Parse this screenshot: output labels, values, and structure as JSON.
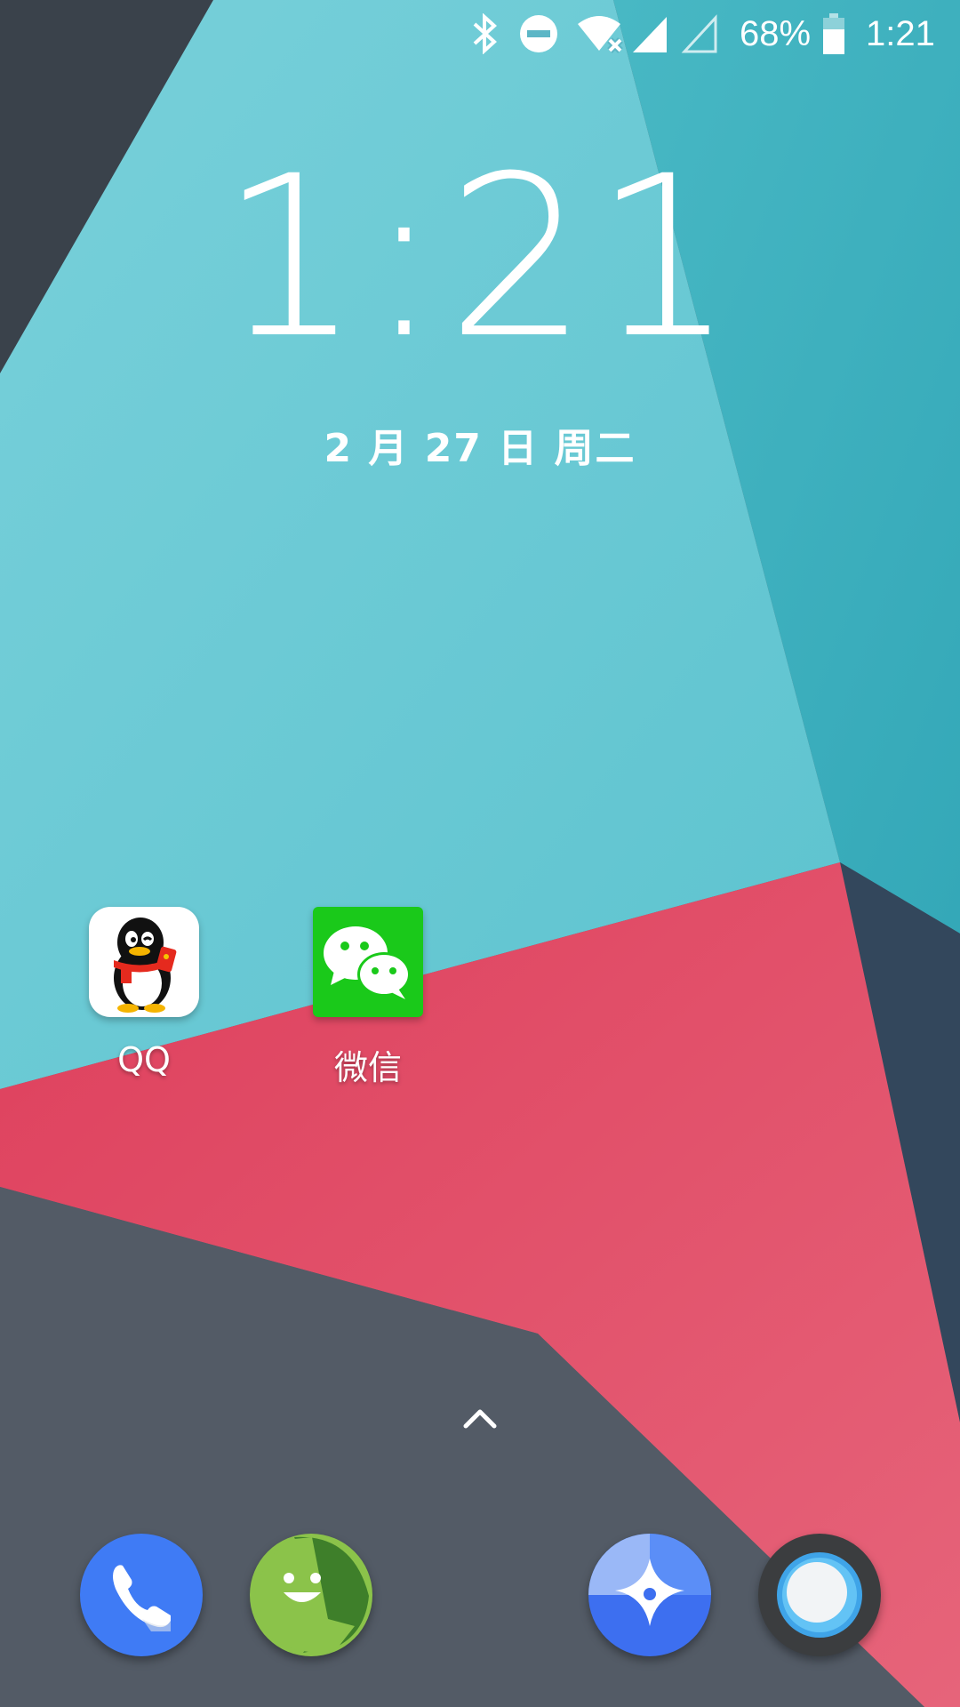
{
  "status_bar": {
    "battery_percent": "68%",
    "time": "1:21",
    "icons": [
      "bluetooth-icon",
      "do-not-disturb-icon",
      "wifi-no-internet-icon",
      "signal-full-icon",
      "signal-empty-icon",
      "battery-icon"
    ]
  },
  "lock_clock": {
    "time": "1:21",
    "date": "2 月 27 日 周二"
  },
  "home_apps": [
    {
      "label": "QQ",
      "icon": "qq-penguin-icon"
    },
    {
      "label": "微信",
      "icon": "wechat-icon"
    }
  ],
  "app_drawer_hint": {
    "icon": "chevron-up-icon"
  },
  "dock": [
    {
      "icon": "phone-icon",
      "color": "#3F7BF5"
    },
    {
      "icon": "messaging-icon",
      "color": "#8BC34A"
    },
    {
      "icon": "news-icon",
      "color": "#3D6FF0"
    },
    {
      "icon": "browser-icon",
      "color": "#333333"
    }
  ],
  "colors": {
    "teal_light": "#6DCBD5",
    "teal_dark": "#3BB1C0",
    "red": "#E04A64",
    "slate": "#4C5560",
    "navy": "#35465A"
  }
}
